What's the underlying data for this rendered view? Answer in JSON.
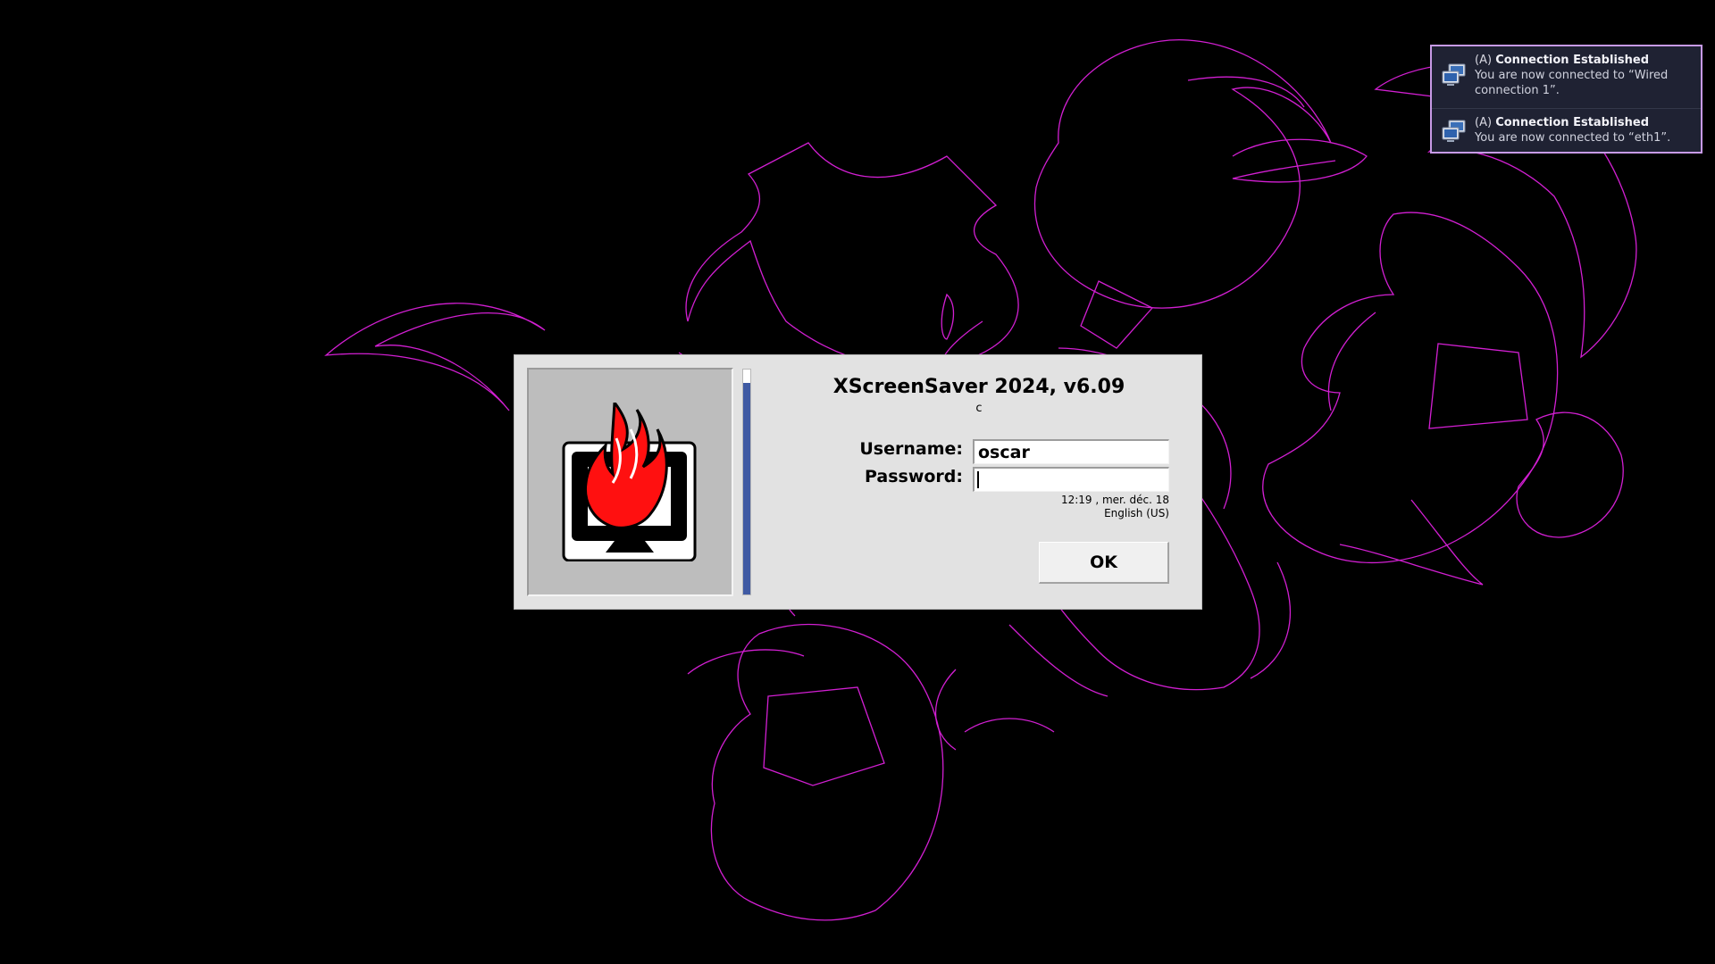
{
  "dialog": {
    "title": "XScreenSaver 2024, v6.09",
    "subtitle": "c",
    "username_label": "Username:",
    "username_value": "oscar",
    "password_label": "Password:",
    "password_value": "",
    "clock": "12:19 , mer. déc. 18",
    "language": "English (US)",
    "ok_label": "OK",
    "progress_remaining_fraction": 0.94
  },
  "notifications": [
    {
      "prefix": "(A)",
      "title": "Connection Established",
      "body": "You are now connected to “Wired connection 1”.",
      "icon": "network-computer-icon"
    },
    {
      "prefix": "(A)",
      "title": "Connection Established",
      "body": "You are now connected to “eth1”.",
      "icon": "network-computer-icon"
    }
  ],
  "colors": {
    "background": "#000000",
    "screensaver_lines": "#d21fd2",
    "dialog_bg": "#e2e2e2",
    "progress_fill": "#3f5aa3",
    "notification_border": "#c79ae6",
    "notification_bg": "#1f2233",
    "logo_flame": "#ff0000"
  }
}
